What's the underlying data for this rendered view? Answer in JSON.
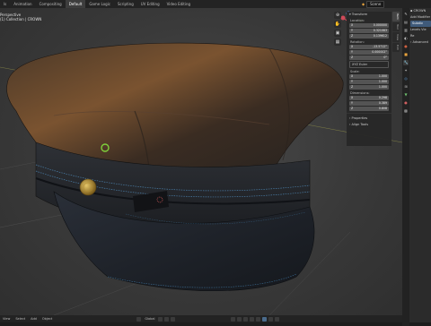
{
  "topbar": {
    "tabs": [
      "Layout",
      "Animation",
      "Compositing",
      "Default",
      "Game Logic",
      "Scripting",
      "UV Editing",
      "Video Editing"
    ],
    "active_tab": "Default",
    "first_label": "ls",
    "scene_label": "Scene"
  },
  "viewport": {
    "view_name": "Perspective",
    "collection_label": "(1) Collection | CROWN"
  },
  "npanel": {
    "header": "Transform",
    "location_label": "Location:",
    "location": [
      {
        "axis": "X",
        "value": "0.000000"
      },
      {
        "axis": "Y",
        "value": "0.321083"
      },
      {
        "axis": "Z",
        "value": "0.139612"
      }
    ],
    "rotation_label": "Rotation:",
    "rotation": [
      {
        "axis": "X",
        "value": "-13.5712°"
      },
      {
        "axis": "Y",
        "value": "0.000002°"
      },
      {
        "axis": "Z",
        "value": "0°"
      }
    ],
    "rotation_mode": "XYZ Euler",
    "scale_label": "Scale:",
    "scale": [
      {
        "axis": "X",
        "value": "1.000"
      },
      {
        "axis": "Y",
        "value": "1.000"
      },
      {
        "axis": "Z",
        "value": "1.000"
      }
    ],
    "dimensions_label": "Dimensions:",
    "dimensions": [
      {
        "axis": "X",
        "value": "0.298"
      },
      {
        "axis": "Y",
        "value": "0.389"
      },
      {
        "axis": "Z",
        "value": "0.808"
      }
    ],
    "properties_label": "Properties",
    "align_label": "Align Tools",
    "tabs": [
      "Item",
      "Tool",
      "View",
      "Edit"
    ]
  },
  "rightpanel": {
    "object_name": "CROWN",
    "add_modifier": "Add Modifier",
    "modifier_name": "Subdiv",
    "levels_label": "Levels Vie",
    "render_label": "Re",
    "advanced_label": "Advanced"
  },
  "statusbar": {
    "menus": [
      "View",
      "Select",
      "Add",
      "Object"
    ],
    "orientation": "Global"
  },
  "colors": {
    "accent_blue": "#4a90d9",
    "active_tab_bg": "#3d3d3d",
    "stitch_blue": "#6fa3c9",
    "brass": "#b8952e",
    "origin_green": "#7fd13b"
  }
}
